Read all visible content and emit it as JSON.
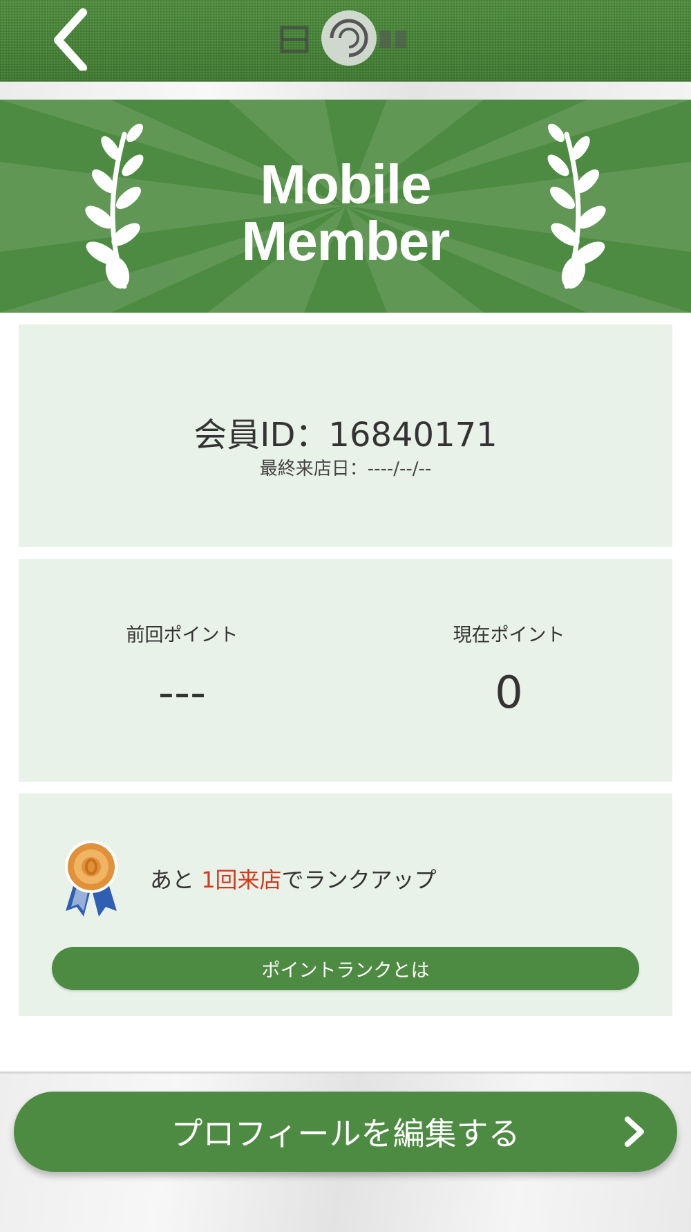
{
  "header": {
    "back_icon": "chevron-left-icon",
    "logo_icon": "store-logo-icon"
  },
  "banner": {
    "title_line1": "Mobile",
    "title_line2": "Member",
    "decoration_icon": "laurel-icon"
  },
  "member": {
    "id_text": "会員ID：16840171",
    "last_visit_text": "最終来店日：----/--/--"
  },
  "points": {
    "previous_label": "前回ポイント",
    "previous_value": "---",
    "current_label": "現在ポイント",
    "current_value": "0"
  },
  "rank": {
    "medal_icon": "bronze-medal-icon",
    "prefix": "あと",
    "highlight": "1回来店",
    "suffix": "でランクアップ",
    "button_label": "ポイントランクとは"
  },
  "footer": {
    "edit_profile_label": "プロフィールを編集する",
    "chevron_icon": "chevron-right-icon"
  },
  "colors": {
    "brand_green": "#4e8b42",
    "card_bg": "#e8f2e8",
    "highlight_red": "#d23a1f"
  }
}
